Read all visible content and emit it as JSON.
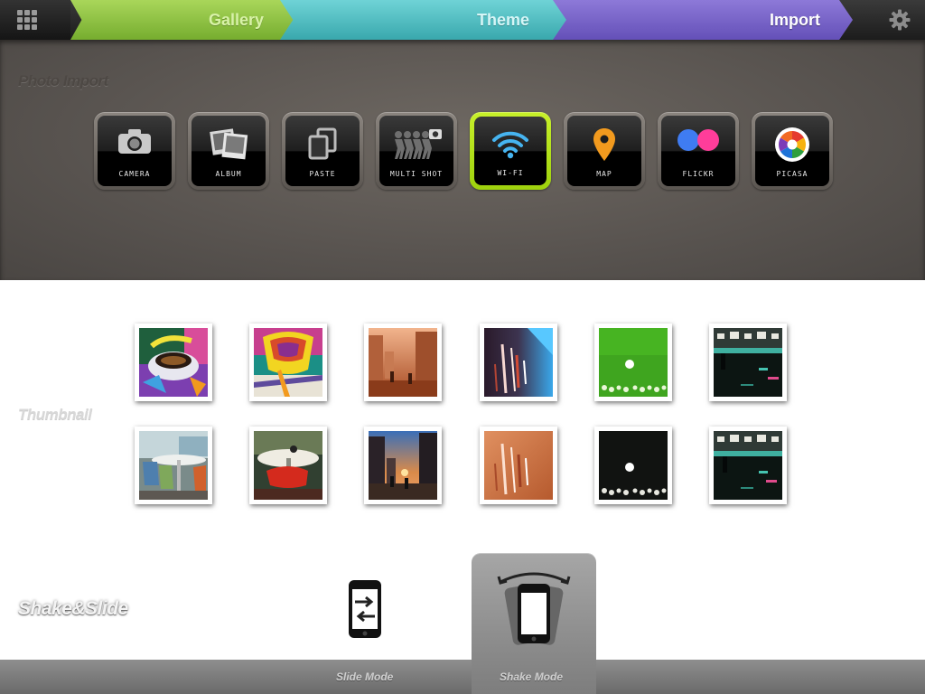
{
  "nav": {
    "grid_icon": "grid-icon",
    "tabs": [
      {
        "label": "Gallery",
        "color": "#8fc43f"
      },
      {
        "label": "Theme",
        "color": "#4cbfc3"
      },
      {
        "label": "Import",
        "color": "#7764c8",
        "active": true
      }
    ],
    "settings_icon": "gear-icon"
  },
  "photo_import": {
    "label": "Photo Import",
    "sources": [
      {
        "label": "CAMERA",
        "icon": "camera-icon"
      },
      {
        "label": "ALBUM",
        "icon": "album-icon"
      },
      {
        "label": "PASTE",
        "icon": "paste-icon"
      },
      {
        "label": "MULTI SHOT",
        "icon": "multi-shot-icon"
      },
      {
        "label": "WI-FI",
        "icon": "wifi-icon",
        "selected": true
      },
      {
        "label": "MAP",
        "icon": "map-pin-icon"
      },
      {
        "label": "FLICKR",
        "icon": "flickr-icon"
      },
      {
        "label": "PICASA",
        "icon": "picasa-icon"
      }
    ],
    "selected_color": "#b5e21c"
  },
  "thumbnails": {
    "label": "Thumbnail",
    "items": [
      {
        "scene": "teacup-posterized"
      },
      {
        "scene": "teacup-posterized-alt"
      },
      {
        "scene": "street-sunset-orange"
      },
      {
        "scene": "motion-blur-blue"
      },
      {
        "scene": "green-lights"
      },
      {
        "scene": "night-plaza"
      },
      {
        "scene": "cafe-chairs"
      },
      {
        "scene": "cafe-table-red-chair"
      },
      {
        "scene": "street-sunset"
      },
      {
        "scene": "motion-blur-orange"
      },
      {
        "scene": "dark-lights"
      },
      {
        "scene": "night-plaza-alt"
      }
    ]
  },
  "shake_slide": {
    "label": "Shake&Slide",
    "modes": [
      {
        "label": "Slide Mode",
        "icon": "slide-phone-icon"
      },
      {
        "label": "Shake Mode",
        "icon": "shake-phone-icon",
        "active": true
      }
    ]
  }
}
